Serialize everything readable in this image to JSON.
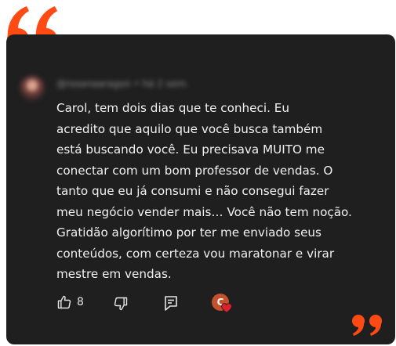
{
  "comment": {
    "author_meta": "@rosanaaragon • há 2 sem.",
    "text": "Carol, tem dois dias que te conheci. Eu\nacredito que aquilo que você busca também\nestá buscando você. Eu precisava MUITO me\nconectar com um bom professor de vendas. O\ntanto que eu já consumi e não consegui fazer\nmeu negócio vender mais… Você não tem noção.\nGratidão algorítimo por ter me enviado seus\nconteúdos, com certeza vou maratonar e virar\nmestre em vendas.",
    "like_count": "8",
    "creator_initial": "C"
  },
  "colors": {
    "accent": "#ff4a14",
    "card_background": "#1f1f1f",
    "text": "#f1f1f1",
    "heart": "#e0202a"
  },
  "icons": {
    "open_quote": "quote-open-icon",
    "close_quote": "quote-close-icon",
    "like": "thumbs-up-icon",
    "dislike": "thumbs-down-icon",
    "reply": "reply-icon",
    "creator_heart": "heart-icon"
  }
}
